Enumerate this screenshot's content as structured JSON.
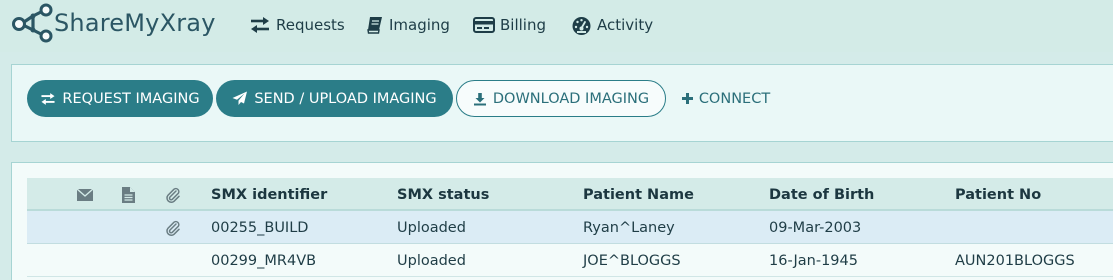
{
  "brand": {
    "name_part1": "Share",
    "name_part2": "MyXray"
  },
  "nav": {
    "items": [
      {
        "label": "Requests",
        "icon": "exchange-arrows-icon"
      },
      {
        "label": "Imaging",
        "icon": "book-icon"
      },
      {
        "label": "Billing",
        "icon": "credit-card-icon"
      },
      {
        "label": "Activity",
        "icon": "dashboard-gauge-icon"
      }
    ]
  },
  "actions": {
    "request_imaging": "REQUEST IMAGING",
    "send_upload_imaging": "SEND / UPLOAD IMAGING",
    "download_imaging": "DOWNLOAD IMAGING",
    "connect": "CONNECT"
  },
  "table": {
    "icon_columns": [
      "envelope-icon",
      "document-icon",
      "paperclip-icon"
    ],
    "columns": [
      "SMX identifier",
      "SMX status",
      "Patient Name",
      "Date of Birth",
      "Patient No"
    ],
    "rows": [
      {
        "has_attachment": true,
        "smx_identifier": "00255_BUILD",
        "smx_status": "Uploaded",
        "patient_name": "Ryan^Laney",
        "dob": "09-Mar-2003",
        "patient_no": ""
      },
      {
        "has_attachment": false,
        "smx_identifier": "00299_MR4VB",
        "smx_status": "Uploaded",
        "patient_name": "JOE^BLOGGS",
        "dob": "16-Jan-1945",
        "patient_no": "AUN201BLOGGS"
      }
    ]
  },
  "colors": {
    "nav_bg": "#d3ebe7",
    "primary": "#2b7d88",
    "panel_bg": "#eaf8f7",
    "selected_row": "#dbecf5"
  }
}
